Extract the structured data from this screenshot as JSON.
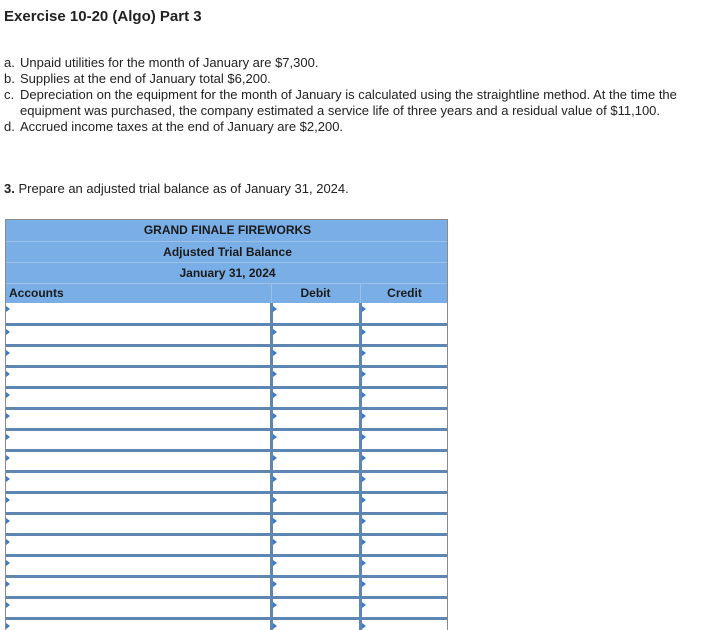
{
  "title": "Exercise 10-20 (Algo) Part 3",
  "items": [
    {
      "label": "a.",
      "text": "Unpaid utilities for the month of January are $7,300."
    },
    {
      "label": "b.",
      "text": "Supplies at the end of January total $6,200."
    },
    {
      "label": "c.",
      "text": "Depreciation on the equipment for the month of January is calculated using the straightline method. At the time the equipment was purchased, the company estimated a service life of three years and a residual value of $11,100."
    },
    {
      "label": "d.",
      "text": "Accrued income taxes at the end of January are $2,200."
    }
  ],
  "question": {
    "number": "3.",
    "text": "Prepare an adjusted trial balance as of January 31, 2024."
  },
  "trial_balance": {
    "company": "GRAND FINALE FIREWORKS",
    "statement": "Adjusted Trial Balance",
    "date": "January 31, 2024",
    "columns": {
      "accounts": "Accounts",
      "debit": "Debit",
      "credit": "Credit"
    },
    "rows": [
      {
        "account": "",
        "debit": "",
        "credit": ""
      },
      {
        "account": "",
        "debit": "",
        "credit": ""
      },
      {
        "account": "",
        "debit": "",
        "credit": ""
      },
      {
        "account": "",
        "debit": "",
        "credit": ""
      },
      {
        "account": "",
        "debit": "",
        "credit": ""
      },
      {
        "account": "",
        "debit": "",
        "credit": ""
      },
      {
        "account": "",
        "debit": "",
        "credit": ""
      },
      {
        "account": "",
        "debit": "",
        "credit": ""
      },
      {
        "account": "",
        "debit": "",
        "credit": ""
      },
      {
        "account": "",
        "debit": "",
        "credit": ""
      },
      {
        "account": "",
        "debit": "",
        "credit": ""
      },
      {
        "account": "",
        "debit": "",
        "credit": ""
      },
      {
        "account": "",
        "debit": "",
        "credit": ""
      },
      {
        "account": "",
        "debit": "",
        "credit": ""
      },
      {
        "account": "",
        "debit": "",
        "credit": ""
      },
      {
        "account": "",
        "debit": "",
        "credit": ""
      }
    ]
  },
  "colors": {
    "header_fill": "#7aaee6",
    "row_border": "#5d86b2",
    "input_marker": "#3c79c8"
  }
}
